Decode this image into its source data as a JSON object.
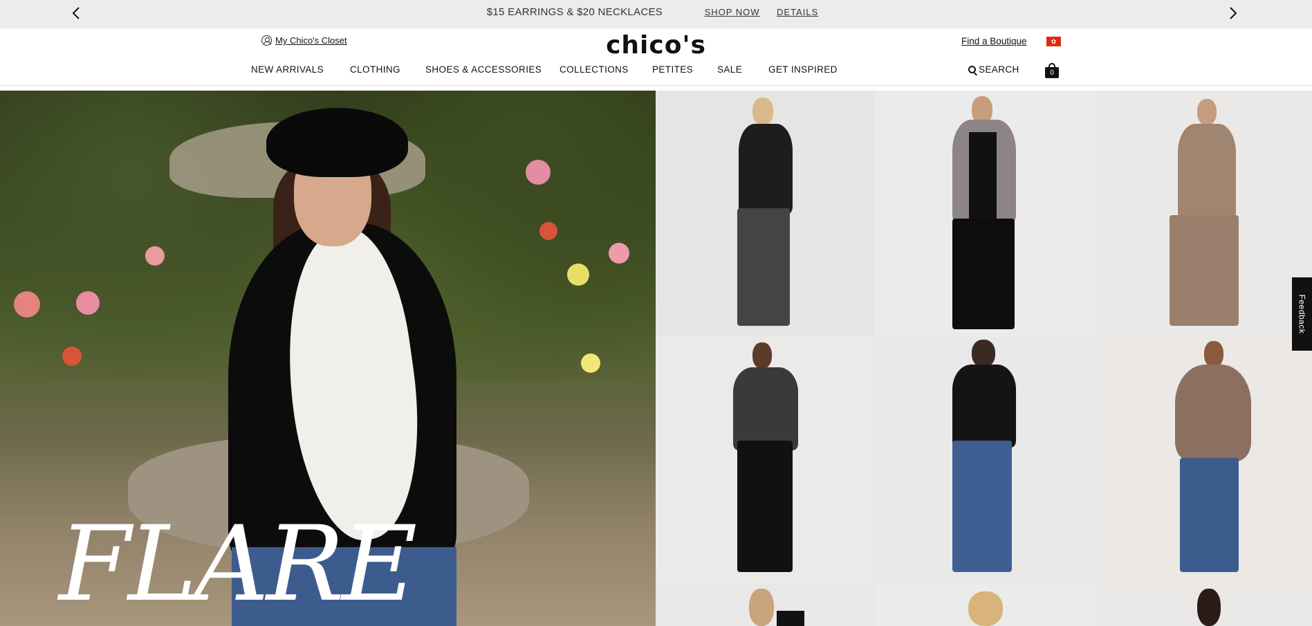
{
  "promo": {
    "message": "$15 EARRINGS & $20 NECKLACES",
    "shop_now": "SHOP NOW",
    "details": "DETAILS"
  },
  "header": {
    "closet_label": "My Chico's Closet",
    "logo": "chico's",
    "boutique_label": "Find a Boutique",
    "search_label": "SEARCH",
    "bag_count": "0"
  },
  "nav": {
    "items": [
      "NEW ARRIVALS",
      "CLOTHING",
      "SHOES & ACCESSORIES",
      "COLLECTIONS",
      "PETITES",
      "SALE",
      "GET INSPIRED"
    ]
  },
  "hero": {
    "title": "FLARE"
  },
  "feedback": {
    "label": "Feedback"
  },
  "colors": {
    "promo_bg": "#ececec",
    "text": "#111111",
    "flag_red": "#de2910"
  },
  "icons": [
    "chevron-left-icon",
    "chevron-right-icon",
    "user-circle-icon",
    "flag-icon",
    "search-icon",
    "shopping-bag-icon"
  ]
}
